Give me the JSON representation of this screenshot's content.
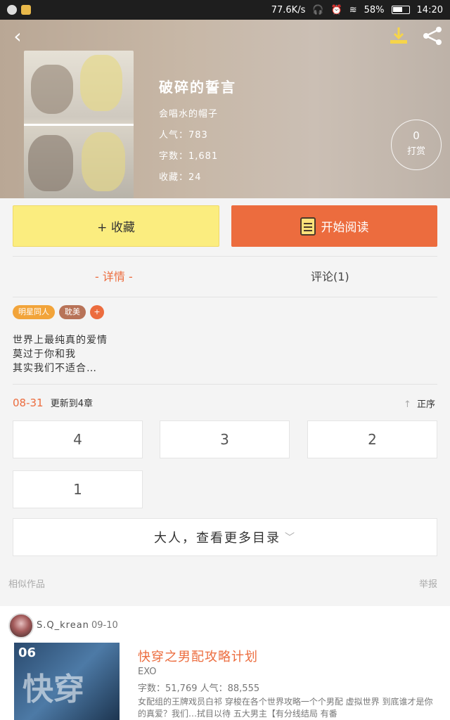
{
  "status_bar": {
    "net_speed": "77.6K/s",
    "battery": "58%",
    "time": "14:20"
  },
  "book": {
    "title": "破碎的誓言",
    "author": "会唱水的帽子",
    "popularity": "人气：783",
    "word_count": "字数：1,681",
    "favorites": "收藏：24",
    "reward_count": "0",
    "reward_label": "打赏"
  },
  "actions": {
    "favorite_label": "+ 收藏",
    "read_label": "开始阅读"
  },
  "tabs": {
    "detail": "- 详情 -",
    "comments": "评论(1)"
  },
  "tags": [
    "明星同人",
    "耽美",
    "+"
  ],
  "intro": [
    "世界上最纯真的爱情",
    "莫过于你和我",
    "其实我们不适合…"
  ],
  "updates": {
    "date": "08-31",
    "text": "更新到4章",
    "order_label": "正序"
  },
  "chapters": [
    "4",
    "3",
    "2",
    "1"
  ],
  "more_label": "大人，查看更多目录",
  "similar_label": "相似作品",
  "report_label": "举报",
  "related": {
    "user": "S.Q_krean",
    "date": "09-10",
    "title": "快穿之男配攻略计划",
    "tag": "EXO",
    "stats": "字数：51,769   人气：88,555",
    "description": "女配组的王牌戏员白祁 穿梭在各个世界攻略一个个男配 虚拟世界 到底谁才是你的真爱？我们…拭目以待 五大男主【有分线结局 有番",
    "cover_text": "快穿",
    "cover_num": "06"
  }
}
